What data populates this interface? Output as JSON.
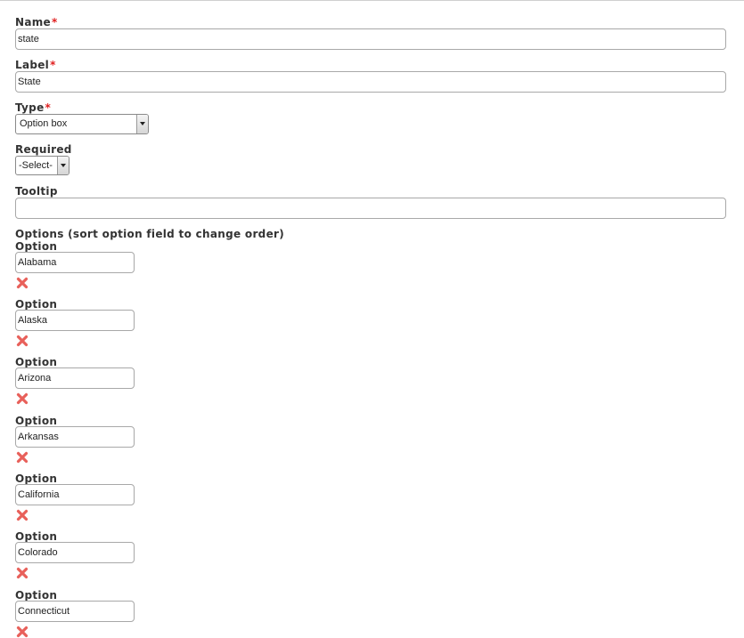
{
  "form": {
    "name": {
      "label": "Name",
      "required_mark": "*",
      "value": "state"
    },
    "label_field": {
      "label": "Label",
      "required_mark": "*",
      "value": "State"
    },
    "type": {
      "label": "Type",
      "required_mark": "*",
      "selected": "Option box"
    },
    "required": {
      "label": "Required",
      "selected": "-Select-"
    },
    "tooltip": {
      "label": "Tooltip",
      "value": ""
    },
    "options": {
      "heading": "Options (sort option field to change order)",
      "items": [
        {
          "label": "Option",
          "value": "Alabama",
          "remove_icon": "red-x-icon"
        },
        {
          "label": "Option",
          "value": "Alaska",
          "remove_icon": "red-x-icon"
        },
        {
          "label": "Option",
          "value": "Arizona",
          "remove_icon": "red-x-icon"
        },
        {
          "label": "Option",
          "value": "Arkansas",
          "remove_icon": "red-x-icon"
        },
        {
          "label": "Option",
          "value": "California",
          "remove_icon": "red-x-icon"
        },
        {
          "label": "Option",
          "value": "Colorado",
          "remove_icon": "red-x-icon"
        },
        {
          "label": "Option",
          "value": "Connecticut",
          "remove_icon": "red-x-icon"
        }
      ]
    }
  },
  "colors": {
    "required_mark": "#e02020",
    "remove_icon": "#e8605a",
    "input_border": "#a8a8a8",
    "label_text": "#333333"
  }
}
